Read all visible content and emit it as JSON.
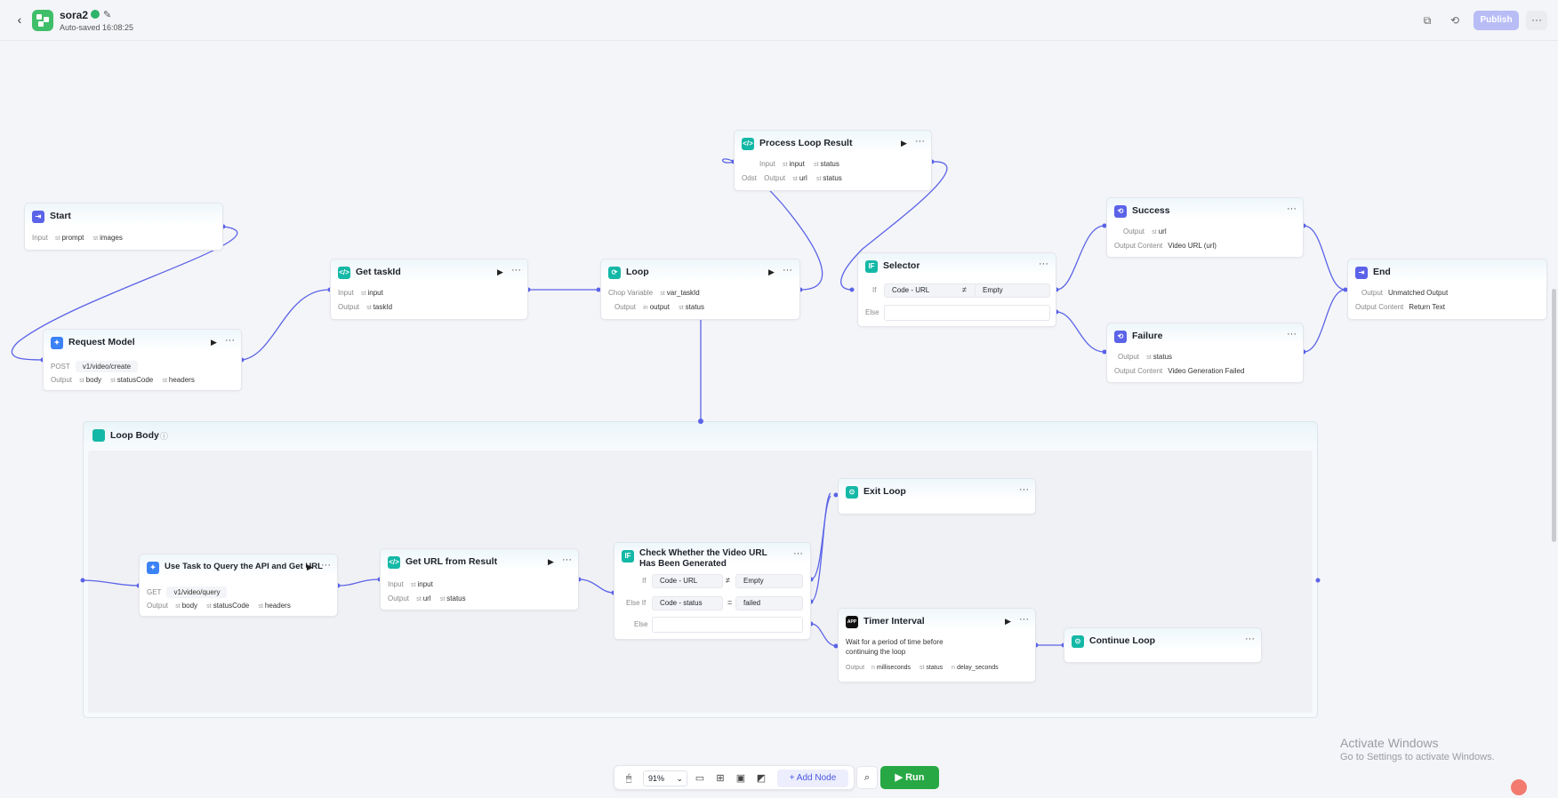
{
  "header": {
    "app_name": "sora2",
    "autosaved": "Auto-saved 16:08:25",
    "publish": "Publish",
    "more": "···"
  },
  "nodes": {
    "start": {
      "title": "Start",
      "input_label": "Input",
      "var1": "prompt",
      "var2": "images"
    },
    "request_model": {
      "title": "Request Model",
      "method": "POST",
      "url": "v1/video/create",
      "output_label": "Output",
      "out1": "body",
      "out2": "statusCode",
      "out3": "headers"
    },
    "get_taskid": {
      "title": "Get taskId",
      "input_label": "Input",
      "in1": "input",
      "output_label": "Output",
      "out1": "taskId"
    },
    "loop": {
      "title": "Loop",
      "loop_var_label": "Chop Variable",
      "loop_var": "var_taskId",
      "output_label": "Output",
      "out1": "output",
      "out2": "status"
    },
    "process_loop_result": {
      "title": "Process Loop Result",
      "input_label": "Input",
      "in1": "input",
      "in2": "status",
      "output_label": "Output",
      "out_prefix": "Odst",
      "out1": "url",
      "out2": "status"
    },
    "selector": {
      "title": "Selector",
      "if_label": "If",
      "cond_left": "Code - URL",
      "cond_op": "≠",
      "cond_right": "Empty",
      "else_label": "Else"
    },
    "success": {
      "title": "Success",
      "output_label": "Output",
      "out1": "url",
      "content_label": "Output Content",
      "content": "Video URL (url)"
    },
    "failure": {
      "title": "Failure",
      "output_label": "Output",
      "out1": "status",
      "content_label": "Output Content",
      "content": "Video Generation Failed"
    },
    "end": {
      "title": "End",
      "output_label": "Output",
      "output": "Unmatched Output",
      "content_label": "Output Content",
      "content": "Return Text"
    },
    "loop_body": {
      "title": "Loop Body"
    },
    "use_task": {
      "title": "Use Task to Query the API and Get URL",
      "method": "GET",
      "url": "v1/video/query",
      "output_label": "Output",
      "out1": "body",
      "out2": "statusCode",
      "out3": "headers"
    },
    "get_url": {
      "title": "Get URL from Result",
      "input_label": "Input",
      "in1": "input",
      "output_label": "Output",
      "out1": "url",
      "out2": "status"
    },
    "check": {
      "title_line1": "Check Whether the Video URL",
      "title_line2": "Has Been Generated",
      "if_label": "If",
      "if_left": "Code - URL",
      "if_op": "≠",
      "if_right": "Empty",
      "elseif_label": "Else If",
      "elseif_left": "Code - status",
      "elseif_op": "=",
      "elseif_right": "failed",
      "else_label": "Else"
    },
    "exit_loop": {
      "title": "Exit Loop"
    },
    "timer": {
      "title": "Timer Interval",
      "desc_line1": "Wait for a period of time before",
      "desc_line2": "continuing the loop",
      "output_label": "Output",
      "out1": "milliseconds",
      "out2": "status",
      "out3": "delay_seconds"
    },
    "continue_loop": {
      "title": "Continue Loop"
    }
  },
  "toolbar": {
    "zoom": "91%",
    "add_node": "Add Node",
    "run": "Run"
  },
  "watermark": {
    "line1": "Activate Windows",
    "line2": "Go to Settings to activate Windows."
  },
  "type_tags": {
    "str": "st",
    "int": "in",
    "num": "n"
  },
  "icons": {
    "app": "grid-icon",
    "edit": "edit-icon",
    "status": "status-dot-icon"
  },
  "colors": {
    "accent": "#5b63e8",
    "edge": "#5b63e8",
    "run": "#27a844",
    "publish": "#b8bdf6",
    "teal": "#14b8a6",
    "blue": "#3b82f6",
    "indigo": "#5b63e8"
  }
}
